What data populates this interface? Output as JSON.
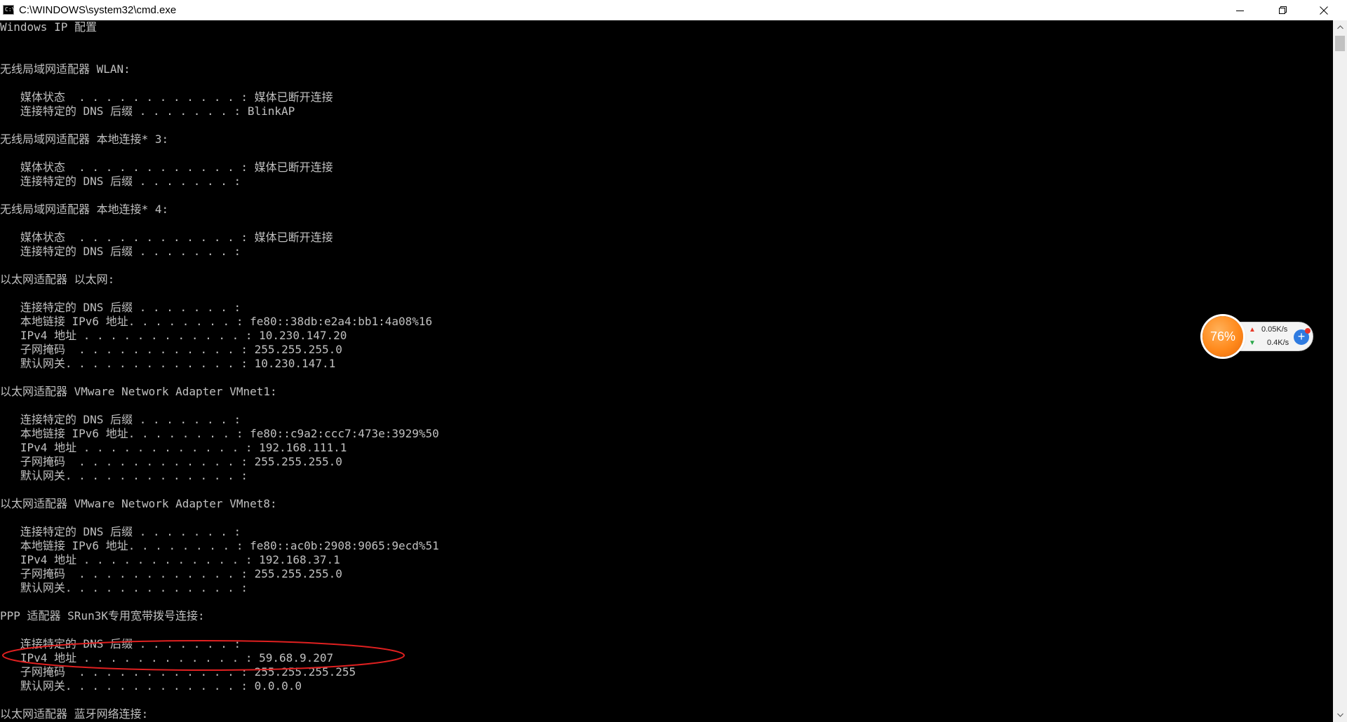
{
  "window": {
    "icon": "C:\\",
    "title": "C:\\WINDOWS\\system32\\cmd.exe",
    "controls": [
      "minimize-icon",
      "restore-icon",
      "close-icon"
    ]
  },
  "console": {
    "lines": [
      "Windows IP 配置",
      "",
      "",
      "无线局域网适配器 WLAN:",
      "",
      "   媒体状态  . . . . . . . . . . . . : 媒体已断开连接",
      "   连接特定的 DNS 后缀 . . . . . . . : BlinkAP",
      "",
      "无线局域网适配器 本地连接* 3:",
      "",
      "   媒体状态  . . . . . . . . . . . . : 媒体已断开连接",
      "   连接特定的 DNS 后缀 . . . . . . . :",
      "",
      "无线局域网适配器 本地连接* 4:",
      "",
      "   媒体状态  . . . . . . . . . . . . : 媒体已断开连接",
      "   连接特定的 DNS 后缀 . . . . . . . :",
      "",
      "以太网适配器 以太网:",
      "",
      "   连接特定的 DNS 后缀 . . . . . . . :",
      "   本地链接 IPv6 地址. . . . . . . . : fe80::38db:e2a4:bb1:4a08%16",
      "   IPv4 地址 . . . . . . . . . . . . : 10.230.147.20",
      "   子网掩码  . . . . . . . . . . . . : 255.255.255.0",
      "   默认网关. . . . . . . . . . . . . : 10.230.147.1",
      "",
      "以太网适配器 VMware Network Adapter VMnet1:",
      "",
      "   连接特定的 DNS 后缀 . . . . . . . :",
      "   本地链接 IPv6 地址. . . . . . . . : fe80::c9a2:ccc7:473e:3929%50",
      "   IPv4 地址 . . . . . . . . . . . . : 192.168.111.1",
      "   子网掩码  . . . . . . . . . . . . : 255.255.255.0",
      "   默认网关. . . . . . . . . . . . . :",
      "",
      "以太网适配器 VMware Network Adapter VMnet8:",
      "",
      "   连接特定的 DNS 后缀 . . . . . . . :",
      "   本地链接 IPv6 地址. . . . . . . . : fe80::ac0b:2908:9065:9ecd%51",
      "   IPv4 地址 . . . . . . . . . . . . : 192.168.37.1",
      "   子网掩码  . . . . . . . . . . . . : 255.255.255.0",
      "   默认网关. . . . . . . . . . . . . :",
      "",
      "PPP 适配器 SRun3K专用宽带拨号连接:",
      "",
      "   连接特定的 DNS 后缀 . . . . . . . :",
      "   IPv4 地址 . . . . . . . . . . . . : 59.68.9.207",
      "   子网掩码  . . . . . . . . . . . . : 255.255.255.255",
      "   默认网关. . . . . . . . . . . . . : 0.0.0.0",
      "",
      "以太网适配器 蓝牙网络连接:"
    ],
    "text_color": "#c0c0c0",
    "background": "#000000"
  },
  "annotation": {
    "shape": "ellipse",
    "color": "#e02020",
    "highlights": "IPv4 地址 . . . . . . . . . . . . : 59.68.9.207"
  },
  "network_widget": {
    "percent": "76%",
    "upload": "0.05K/s",
    "download": "0.4K/s",
    "colors": {
      "ball": "#ff8a1c",
      "plus": "#2f7be0",
      "dot": "#e8342a"
    }
  }
}
